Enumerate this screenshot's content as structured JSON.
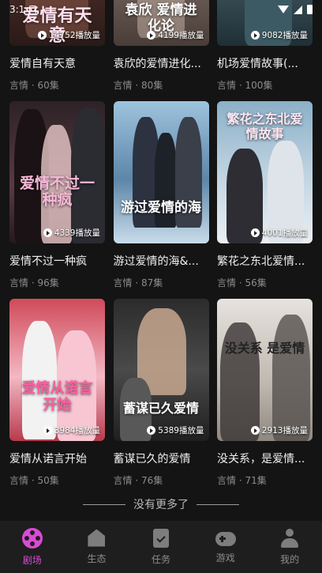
{
  "status": {
    "time": "3:1"
  },
  "rows": [
    [
      {
        "title": "爱情自有天意",
        "meta": "言情 · 60集",
        "plays": "14752播放量",
        "poster_text": "爱情有天意",
        "bg": "#4a2f2c"
      },
      {
        "title": "袁欣的爱情进化...",
        "meta": "言情 · 80集",
        "plays": "4199播放量",
        "poster_text": "袁欣 爱情进化论",
        "bg": "#6b5c55"
      },
      {
        "title": "机场爱情故事(...",
        "meta": "言情 · 100集",
        "plays": "9082播放量",
        "poster_text": "",
        "bg": "#2f4a52"
      }
    ],
    [
      {
        "title": "爱情不过一种疯",
        "meta": "言情 · 96集",
        "plays": "4339播放量",
        "poster_text": "爱情不过一种疯",
        "bg": "#3a2a30"
      },
      {
        "title": "游过爱情的海&...",
        "meta": "言情 · 87集",
        "plays": "",
        "poster_text": "游过爱情的海",
        "bg": "#7aa0c0"
      },
      {
        "title": "繁花之东北爱情...",
        "meta": "言情 · 56集",
        "plays": "4001播放量",
        "poster_text": "繁花之东北爱情故事",
        "bg": "#6f8fa6"
      }
    ],
    [
      {
        "title": "爱情从诺言开始",
        "meta": "言情 · 50集",
        "plays": "3984播放量",
        "poster_text": "爱情从诺言开始",
        "bg": "#b8414f"
      },
      {
        "title": "蓄谋已久的爱情",
        "meta": "言情 · 76集",
        "plays": "5389播放量",
        "poster_text": "蓄谋已久爱情",
        "bg": "#3a3a3a"
      },
      {
        "title": "没关系，是爱情...",
        "meta": "言情 · 71集",
        "plays": "2913播放量",
        "poster_text": "没关系 是爱情",
        "bg": "#cfcac4"
      }
    ]
  ],
  "end_text": "没有更多了",
  "tabs": [
    {
      "label": "剧场",
      "icon": "film-reel-icon",
      "active": true
    },
    {
      "label": "生态",
      "icon": "house-icon",
      "active": false
    },
    {
      "label": "任务",
      "icon": "clipboard-check-icon",
      "active": false
    },
    {
      "label": "游戏",
      "icon": "gamepad-icon",
      "active": false
    },
    {
      "label": "我的",
      "icon": "person-icon",
      "active": false
    }
  ],
  "colors": {
    "accent": "#d94bd6",
    "background": "#141414",
    "tabbar": "#1e1e1e"
  }
}
